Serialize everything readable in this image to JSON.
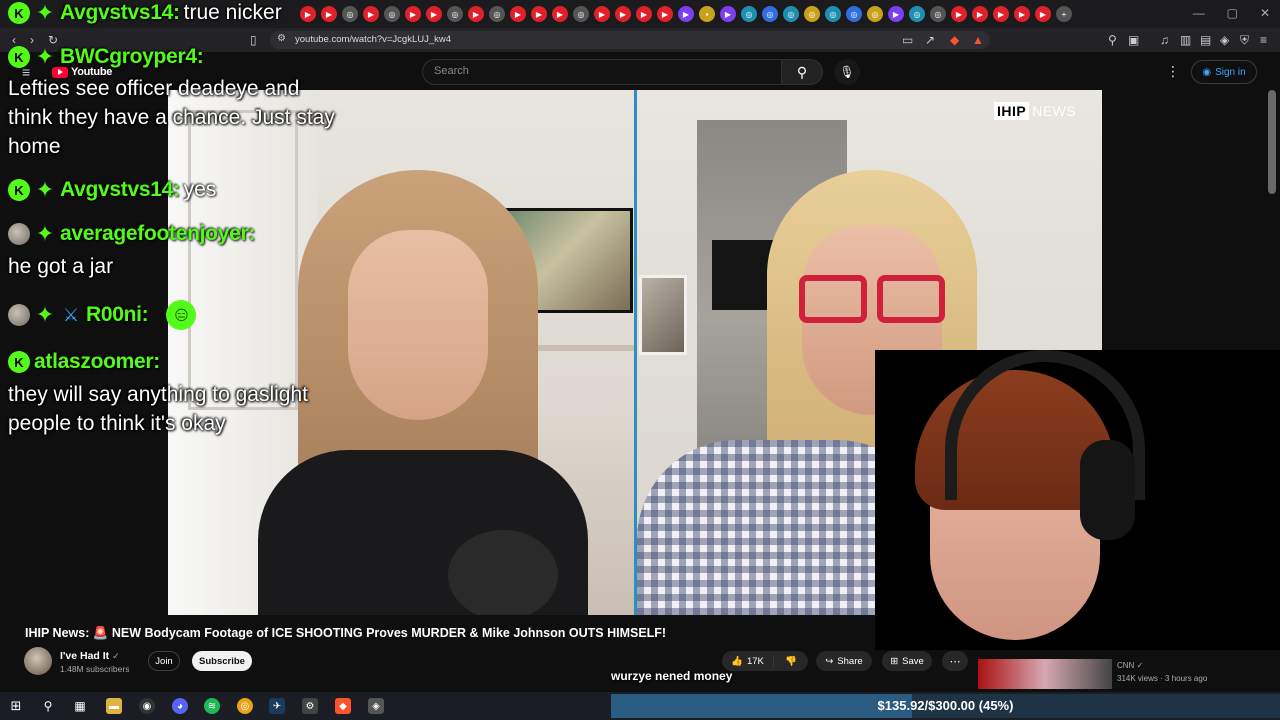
{
  "browser": {
    "url": "youtube.com/watch?v=JcgkLUJ_kw4"
  },
  "youtube": {
    "logo_text": "Youtube",
    "search_placeholder": "Search",
    "signin_label": "Sign in"
  },
  "video": {
    "watermark_box": "IHIP",
    "watermark_news": "NEWS",
    "title": "IHIP News: 🚨 NEW Bodycam Footage of ICE SHOOTING Proves MURDER & Mike Johnson OUTS HIMSELF!",
    "caption": "wurzye nened money"
  },
  "channel": {
    "name": "I've Had It",
    "subscribers": "1.48M subscribers",
    "join_label": "Join",
    "subscribe_label": "Subscribe"
  },
  "actions": {
    "like_count": "17K",
    "share_label": "Share",
    "save_label": "Save"
  },
  "related": {
    "channel": "CNN",
    "meta": "314K views · 3 hours ago"
  },
  "chat": [
    {
      "user": "Avgvstvs14:",
      "text": "true nicker"
    },
    {
      "user": "BWCgroyper4:",
      "text": "Lefties see officer deadeye and think they have a chance. Just stay home"
    },
    {
      "user": "Avgvstvs14:",
      "text": "yes"
    },
    {
      "user": "averagefootenjoyer:",
      "text": "he got a jar"
    },
    {
      "user": "R00ni:",
      "text": ""
    },
    {
      "user": "atlaszoomer:",
      "text": "they will say anything to gaslight people to think it's okay"
    }
  ],
  "goal": {
    "text": "$135.92/$300.00 (45%)",
    "progress": 0.45
  },
  "colors": {
    "kick_green": "#53fc18",
    "yt_red": "#ff0033",
    "link_blue": "#3ea6ff",
    "glasses_red": "#d0213c"
  },
  "icons": {
    "search": "search-icon",
    "mic": "mic-icon",
    "like": "thumbs-up-icon",
    "dislike": "thumbs-down-icon",
    "share": "share-icon",
    "save": "save-icon"
  }
}
